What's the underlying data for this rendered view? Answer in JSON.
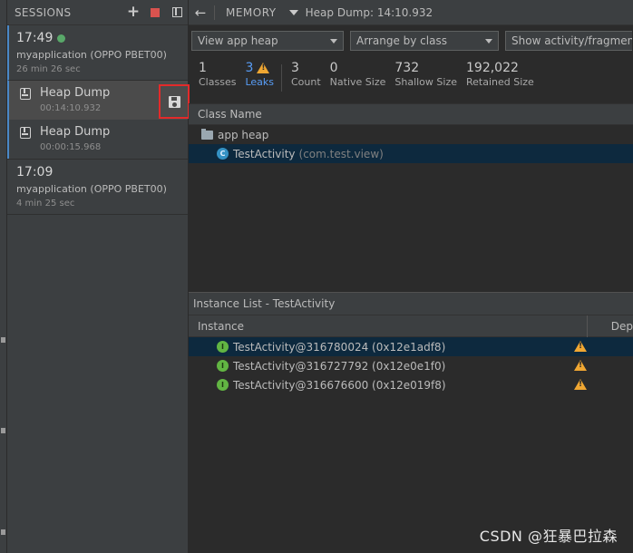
{
  "sessions": {
    "title": "SESSIONS",
    "items": [
      {
        "time": "17:49",
        "app": "myapplication (OPPO PBET00)",
        "duration": "26 min 26 sec",
        "artifacts": [
          {
            "name": "Heap Dump",
            "time": "00:14:10.932"
          },
          {
            "name": "Heap Dump",
            "time": "00:00:15.968"
          }
        ]
      },
      {
        "time": "17:09",
        "app": "myapplication (OPPO PBET00)",
        "duration": "4 min 25 sec"
      }
    ]
  },
  "toolbar": {
    "profiler": "MEMORY",
    "title": "Heap Dump: 14:10.932"
  },
  "filters": {
    "heap": "View app heap",
    "arrange": "Arrange by class",
    "activity": "Show activity/fragment leaks"
  },
  "stats": [
    {
      "value": "1",
      "label": "Classes"
    },
    {
      "value": "3",
      "label": "Leaks"
    },
    {
      "value": "3",
      "label": "Count"
    },
    {
      "value": "0",
      "label": "Native Size"
    },
    {
      "value": "732",
      "label": "Shallow Size"
    },
    {
      "value": "192,022",
      "label": "Retained Size"
    }
  ],
  "class_table": {
    "header": "Class Name",
    "heap_name": "app heap",
    "class_name": "TestActivity",
    "class_package": "(com.test.view)",
    "class_icon_letter": "C"
  },
  "instance_panel": {
    "title": "Instance List - TestActivity",
    "col_instance": "Instance",
    "col_depth": "Dep",
    "icon_letter": "I",
    "rows": [
      "TestActivity@316780024 (0x12e1adf8)",
      "TestActivity@316727792 (0x12e0e1f0)",
      "TestActivity@316676600 (0x12e019f8)"
    ]
  },
  "watermark": "CSDN @狂暴巴拉森",
  "colors": {
    "accent": "#4a88c7",
    "leak": "#589df6",
    "warning": "#f0a732",
    "highlight": "#e32a2a",
    "recording": "#59a869"
  }
}
